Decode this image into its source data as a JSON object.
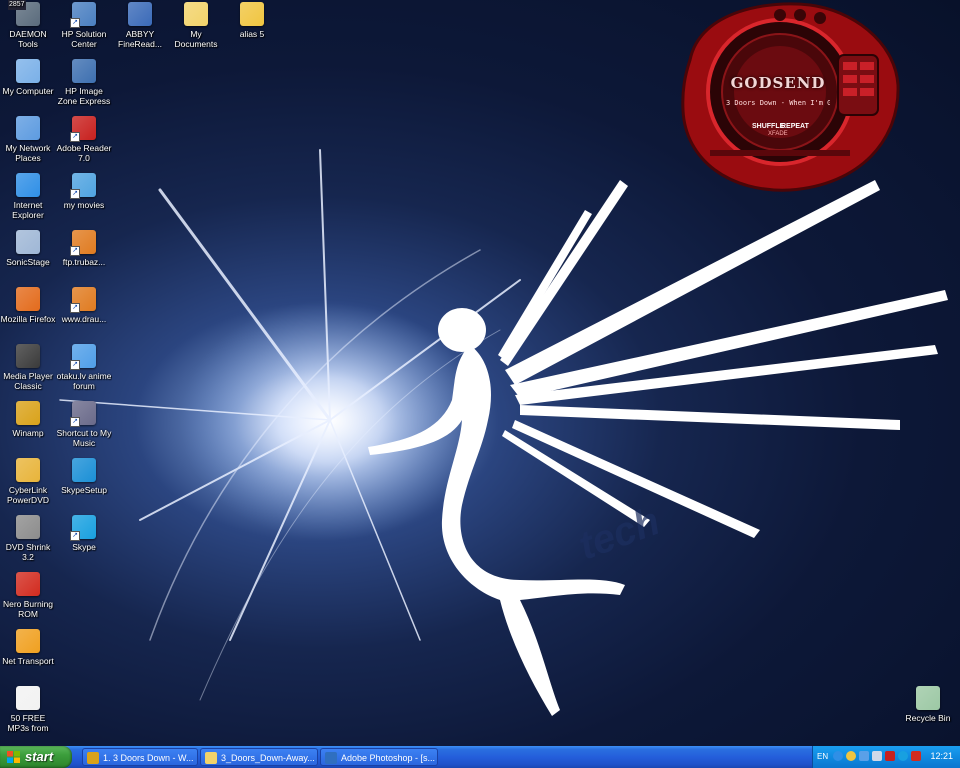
{
  "desktop": {
    "icons": [
      {
        "name": "daemon-tools",
        "label": "DAEMON Tools",
        "badge": "2857",
        "color": "#5a6b7c"
      },
      {
        "name": "my-computer",
        "label": "My Computer",
        "color": "#7ab0e8"
      },
      {
        "name": "my-network-places",
        "label": "My Network Places",
        "color": "#5d9be0"
      },
      {
        "name": "internet-explorer",
        "label": "Internet Explorer",
        "color": "#2f8fe6"
      },
      {
        "name": "sonicstage",
        "label": "SonicStage",
        "color": "#9fb7d6"
      },
      {
        "name": "mozilla-firefox",
        "label": "Mozilla Firefox",
        "color": "#e36b1c"
      },
      {
        "name": "media-player-classic",
        "label": "Media Player Classic",
        "color": "#3a3a3a"
      },
      {
        "name": "winamp",
        "label": "Winamp",
        "color": "#d9a21a"
      },
      {
        "name": "cyberlink-powerdvd",
        "label": "CyberLink PowerDVD",
        "color": "#e8b43a"
      },
      {
        "name": "dvd-shrink",
        "label": "DVD Shrink 3.2",
        "color": "#8c8c8c"
      },
      {
        "name": "nero-burning-rom",
        "label": "Nero Burning ROM",
        "color": "#d22b1f"
      },
      {
        "name": "net-transport",
        "label": "Net Transport",
        "color": "#f0a020"
      },
      {
        "name": "free-mp3s-emusic",
        "label": "50 FREE MP3s from eMusic!",
        "color": "#f2f2f2"
      },
      {
        "name": "hp-solution-center",
        "label": "HP Solution Center",
        "color": "#4a7fc1"
      },
      {
        "name": "hp-image-zone-express",
        "label": "HP Image Zone Express",
        "color": "#3d6fb0"
      },
      {
        "name": "adobe-reader",
        "label": "Adobe Reader 7.0",
        "color": "#c8201e"
      },
      {
        "name": "my-movies",
        "label": "my movies",
        "color": "#4fa3e0"
      },
      {
        "name": "ftp-trubaz",
        "label": "ftp.trubaz...",
        "color": "#e07b20"
      },
      {
        "name": "www-drau",
        "label": "www.drau...",
        "color": "#e07b20"
      },
      {
        "name": "otaku-lv-anime-forum",
        "label": "otaku.lv anime forum",
        "color": "#4f9ee8"
      },
      {
        "name": "shortcut-to-my-music",
        "label": "Shortcut to My Music",
        "color": "#6a6a8a"
      },
      {
        "name": "skypesetup",
        "label": "SkypeSetup",
        "color": "#1a8fd6"
      },
      {
        "name": "skype",
        "label": "Skype",
        "color": "#18a0e0"
      },
      {
        "name": "abbyy-finereader",
        "label": "ABBYY FineRead...",
        "color": "#3a6ab8"
      },
      {
        "name": "my-documents",
        "label": "My Documents",
        "color": "#f2d36a"
      },
      {
        "name": "alias-5",
        "label": "alias 5",
        "color": "#f0c540"
      },
      {
        "name": "recycle-bin",
        "label": "Recycle Bin",
        "color": "#9cc8a4"
      }
    ]
  },
  "player": {
    "title": "GODSEND",
    "track": "3 Doors Down - When I'm Go",
    "shuffle": "SHUFFLE",
    "repeat": "REPEAT",
    "xfade": "XFADE",
    "accent": "#c4141a"
  },
  "taskbar": {
    "start_label": "start",
    "tasks": [
      {
        "label": "1. 3 Doors Down - W...",
        "icon": "winamp-icon"
      },
      {
        "label": "3_Doors_Down-Away...",
        "icon": "folder-icon"
      },
      {
        "label": "Adobe Photoshop - [s...",
        "icon": "photoshop-icon"
      }
    ],
    "tray": {
      "lang": "EN",
      "clock": "12:21"
    }
  }
}
